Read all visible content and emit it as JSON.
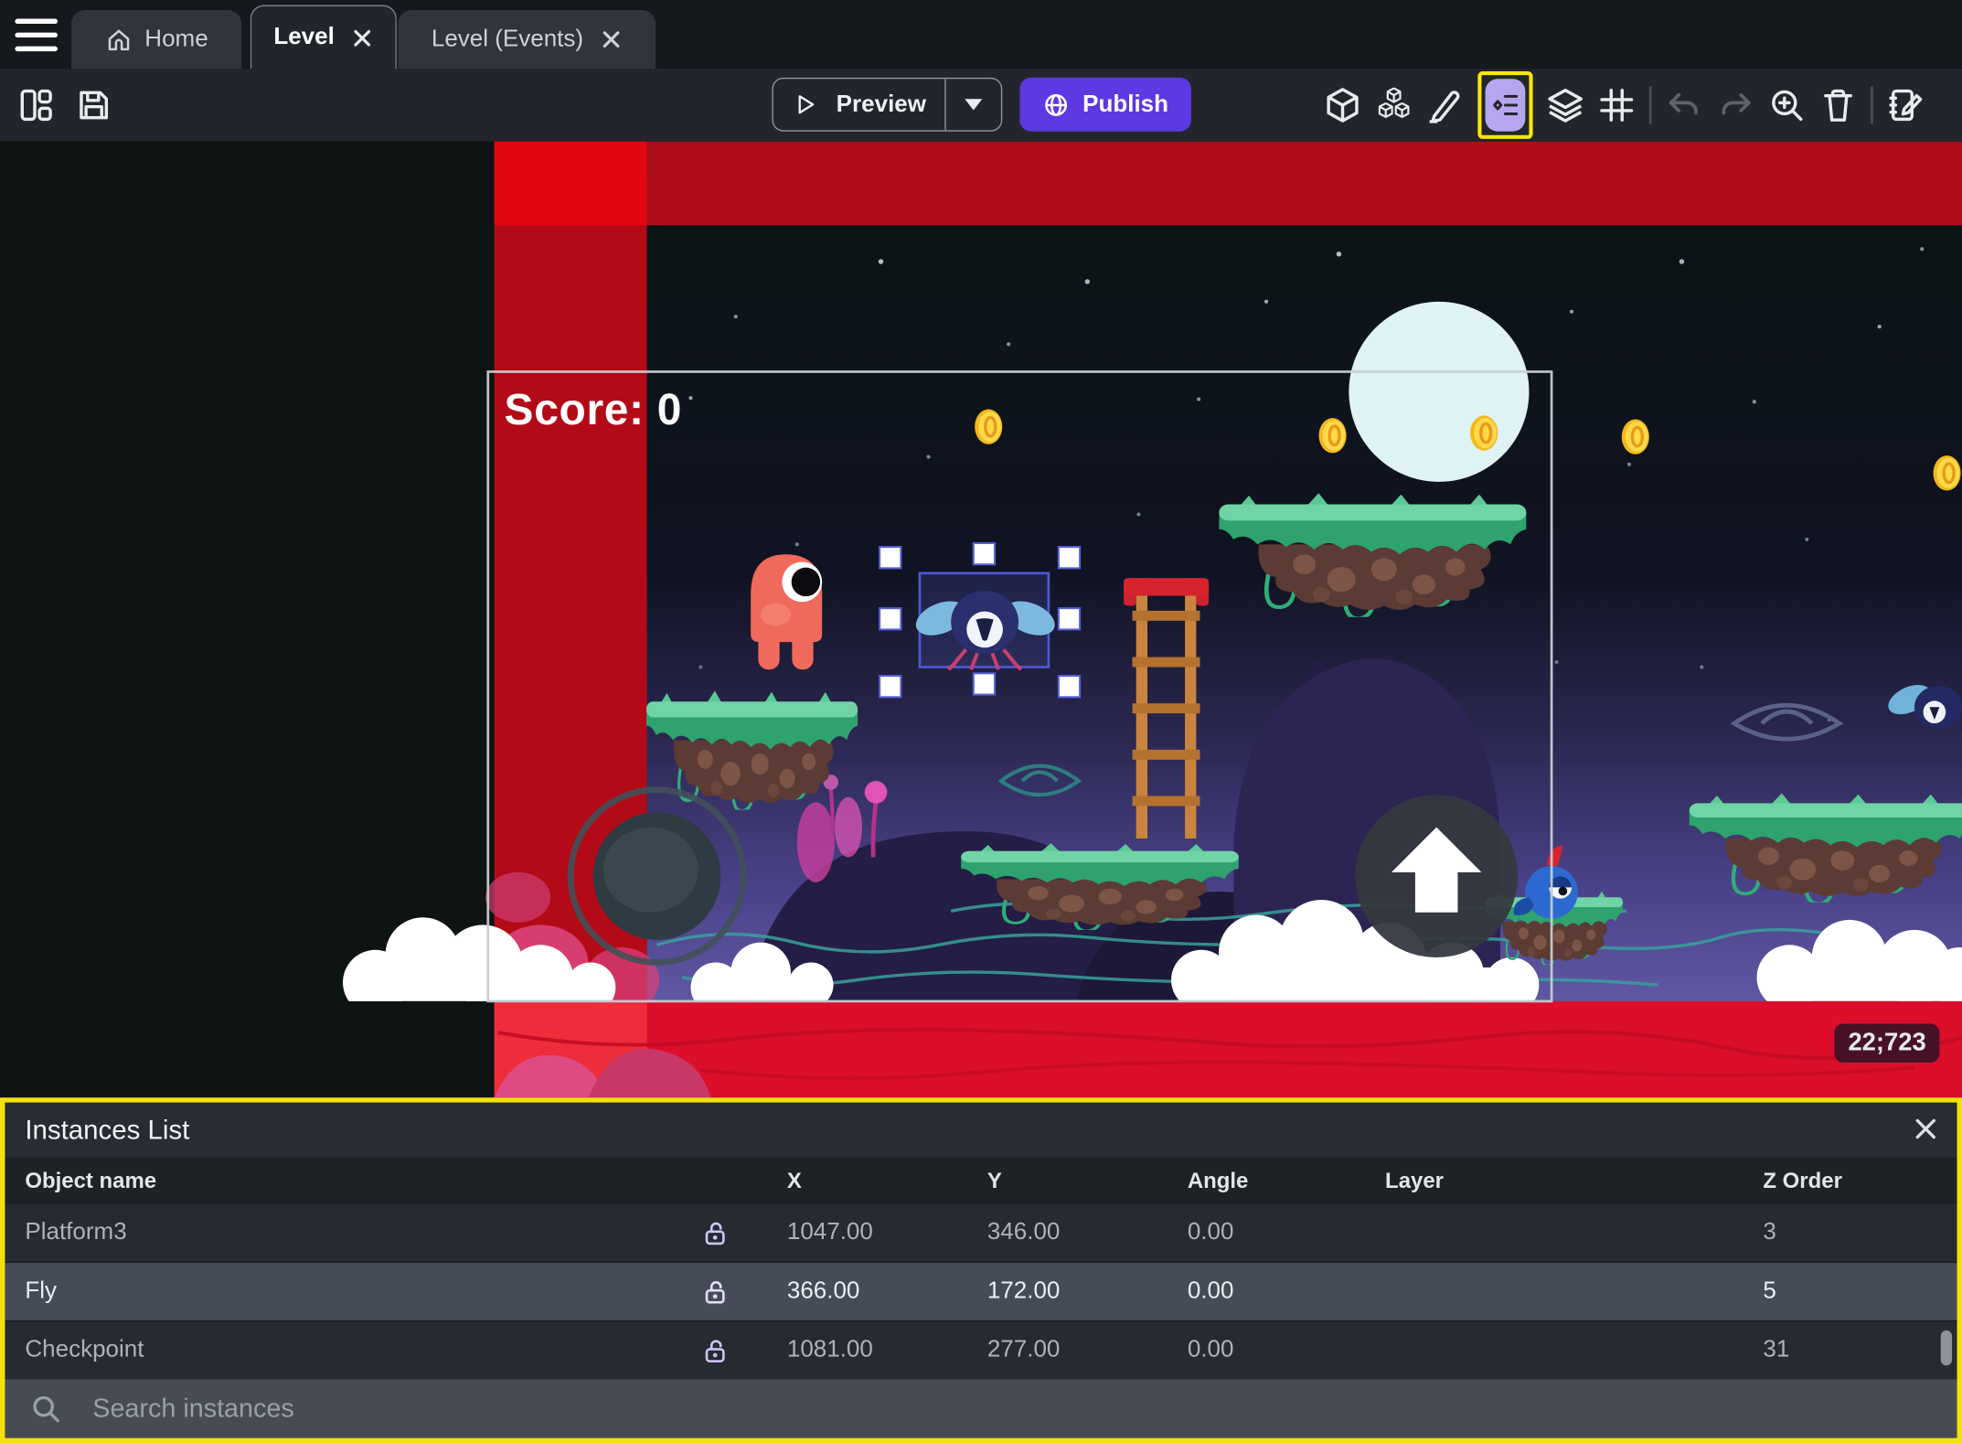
{
  "window": {
    "tabs": [
      {
        "label": "Home"
      },
      {
        "label": "Level"
      },
      {
        "label": "Level (Events)"
      }
    ]
  },
  "toolbar": {
    "preview_label": "Preview",
    "publish_label": "Publish"
  },
  "canvas": {
    "score_label": "Score: 0",
    "coords_badge": "22;723"
  },
  "instances_panel": {
    "title": "Instances List",
    "columns": [
      "Object name",
      "X",
      "Y",
      "Angle",
      "Layer",
      "Z Order"
    ],
    "rows": [
      {
        "name": "Platform3",
        "x": "1047.00",
        "y": "346.00",
        "angle": "0.00",
        "layer": "",
        "z_order": "3",
        "locked": "unlocked"
      },
      {
        "name": "Fly",
        "x": "366.00",
        "y": "172.00",
        "angle": "0.00",
        "layer": "",
        "z_order": "5",
        "locked": "unlocked"
      },
      {
        "name": "Checkpoint",
        "x": "1081.00",
        "y": "277.00",
        "angle": "0.00",
        "layer": "",
        "z_order": "31",
        "locked": "unlocked"
      }
    ],
    "search_placeholder": "Search instances"
  },
  "colors": {
    "publish_purple": "#5e38e0",
    "toolbar_highlight_yellow": "#ffe70a",
    "panel_highlight_yellow": "#f2e10c",
    "active_tool_pill": "#b7a6ef",
    "selection_blue": "#4d58cf",
    "scene_red_band": "#b00d1a",
    "scene_red_stripe": "#b30a18",
    "scene_bottom_red": "#dc0e2a"
  }
}
